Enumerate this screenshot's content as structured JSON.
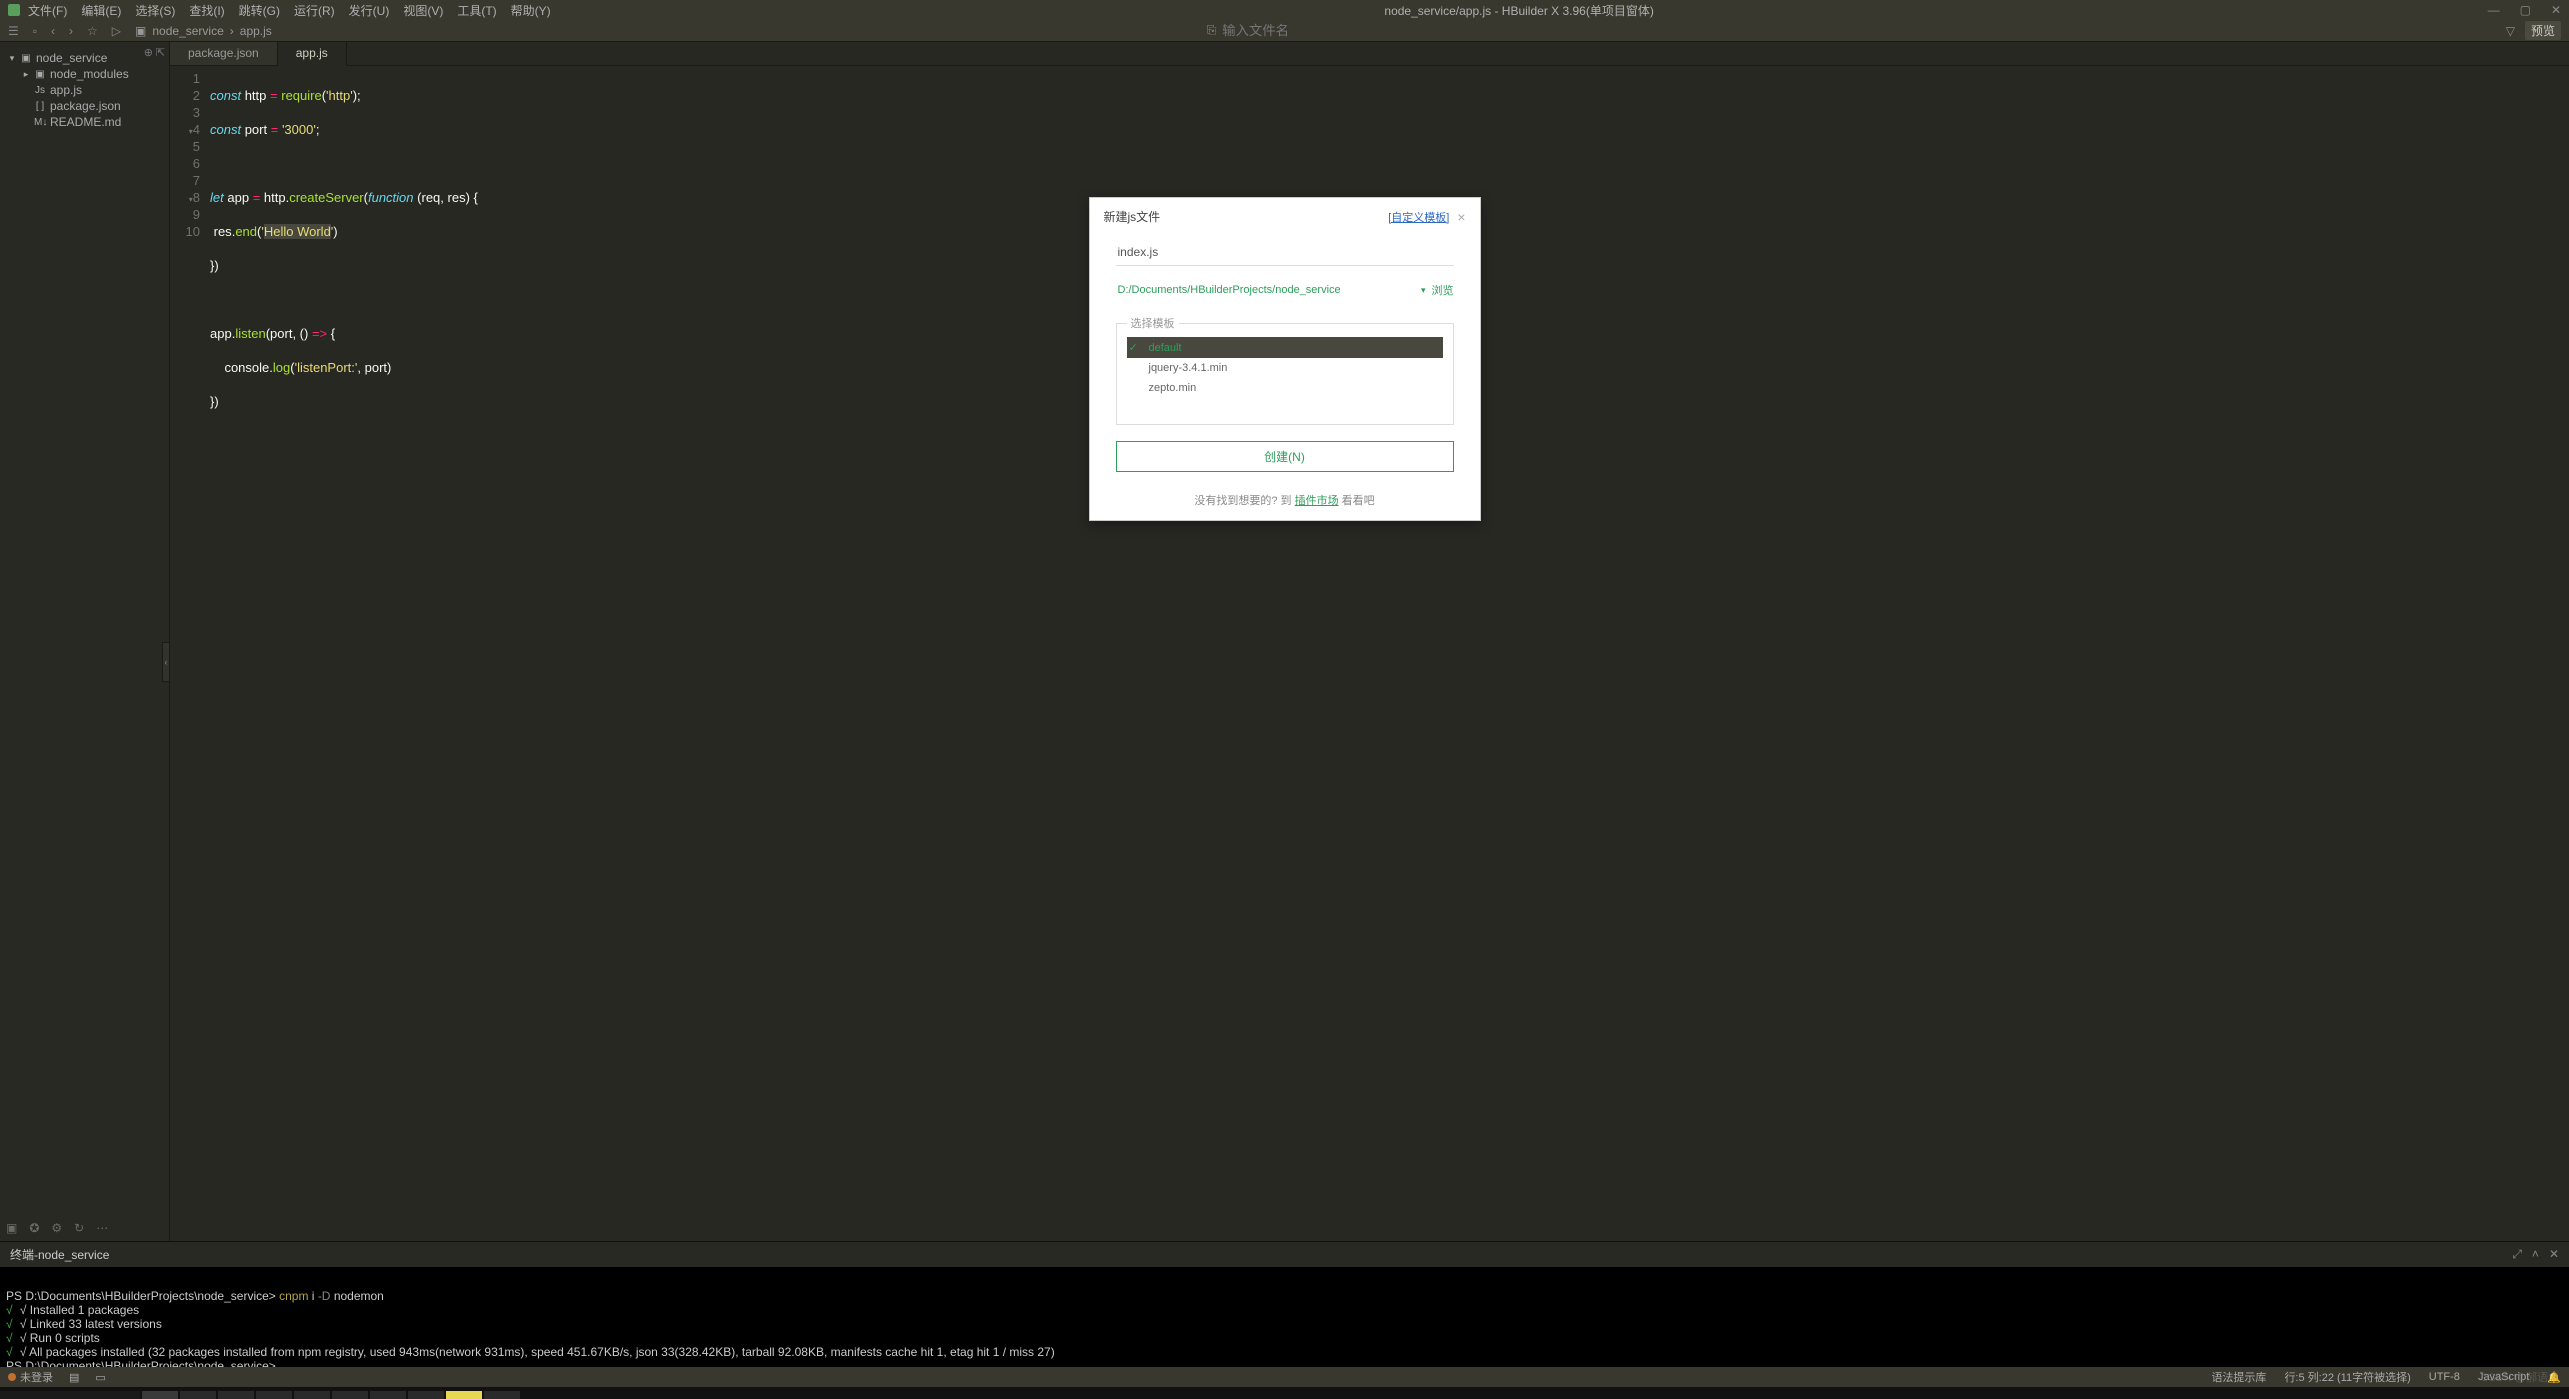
{
  "window": {
    "title": "node_service/app.js - HBuilder X 3.96(单项目窗体)",
    "menus": [
      "文件(F)",
      "编辑(E)",
      "选择(S)",
      "查找(I)",
      "跳转(G)",
      "运行(R)",
      "发行(U)",
      "视图(V)",
      "工具(T)",
      "帮助(Y)"
    ],
    "controls": {
      "min": "—",
      "max": "▢",
      "close": "✕"
    }
  },
  "toolbar": {
    "breadcrumb": {
      "folder_icon": "▣",
      "project": "node_service",
      "sep": "›",
      "file": "app.js"
    },
    "search_icon": "⎘",
    "search_placeholder": "输入文件名",
    "filter_icon": "▽",
    "preview": "预览"
  },
  "sidebar": {
    "pin": "⊕",
    "collapse": "⇱",
    "tree": [
      {
        "level": 1,
        "arr": "▾",
        "ficon": "▣",
        "label": "node_service"
      },
      {
        "level": 2,
        "arr": "▸",
        "ficon": "▣",
        "label": "node_modules"
      },
      {
        "level": 2,
        "arr": "",
        "ficon": "Js",
        "label": "app.js"
      },
      {
        "level": 2,
        "arr": "",
        "ficon": "[ ]",
        "label": "package.json"
      },
      {
        "level": 2,
        "arr": "",
        "ficon": "M↓",
        "label": "README.md"
      }
    ],
    "bottom_icons": [
      "▣",
      "✪",
      "⚙",
      "↻",
      "⋯"
    ]
  },
  "tabs": [
    {
      "label": "package.json",
      "active": false
    },
    {
      "label": "app.js",
      "active": true
    }
  ],
  "code": {
    "lines": [
      "1",
      "2",
      "3",
      "4",
      "5",
      "6",
      "7",
      "8",
      "9",
      "10"
    ]
  },
  "dialog": {
    "title": "新建js文件",
    "custom_link": "[自定义模板]",
    "filename": "index.js",
    "path": "D:/Documents/HBuilderProjects/node_service",
    "browse": "浏览",
    "legend": "选择模板",
    "templates": [
      {
        "name": "default",
        "selected": true
      },
      {
        "name": "jquery-3.4.1.min",
        "selected": false
      },
      {
        "name": "zepto.min",
        "selected": false
      }
    ],
    "create": "创建(N)",
    "footer_pre": "没有找到想要的? 到 ",
    "footer_link": "插件市场",
    "footer_post": " 看看吧"
  },
  "terminal": {
    "title": "终端-node_service",
    "lines": [
      "PS D:\\Documents\\HBuilderProjects\\node_service> cnpm i -D nodemon",
      "√ Installed 1 packages",
      "√ Linked 33 latest versions",
      "√ Run 0 scripts",
      "√ All packages installed (32 packages installed from npm registry, used 943ms(network 931ms), speed 451.67KB/s, json 33(328.42KB), tarball 92.08KB, manifests cache hit 1, etag hit 1 / miss 27)",
      "PS D:\\Documents\\HBuilderProjects\\node_service> _"
    ]
  },
  "status": {
    "login": "未登录",
    "syntax": "语法提示库",
    "pos": "行:5  列:22 (11字符被选择)",
    "encoding": "UTF-8",
    "lang": "JavaScript"
  },
  "watermark": "CSDN @郝语念"
}
